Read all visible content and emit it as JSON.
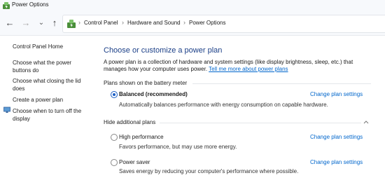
{
  "window": {
    "title": "Power Options"
  },
  "nav": {
    "back_icon": "back-arrow-icon",
    "forward_icon": "forward-arrow-icon",
    "recent_icon": "chevron-down-icon",
    "up_icon": "up-arrow-icon"
  },
  "breadcrumb": [
    "Control Panel",
    "Hardware and Sound",
    "Power Options"
  ],
  "sidebar": {
    "home": "Control Panel Home",
    "links": [
      "Choose what the power",
      "buttons do",
      "Choose what closing the lid",
      "does",
      "Create a power plan",
      "Choose when to turn off the",
      "display"
    ]
  },
  "main": {
    "title": "Choose or customize a power plan",
    "intro_line1": "A power plan is a collection of hardware and system settings (like display brightness, sleep, etc.) that",
    "intro_line2": "manages how your computer uses power.",
    "intro_link": "Tell me more about power plans",
    "battery_group": "Plans shown on the battery meter",
    "hidden_group": "Hide additional plans",
    "change_label": "Change plan settings",
    "plans": [
      {
        "name": "Balanced (recommended)",
        "desc": "Automatically balances performance with energy consumption on capable hardware.",
        "selected": true
      },
      {
        "name": "High performance",
        "desc": "Favors performance, but may use more energy.",
        "selected": false
      },
      {
        "name": "Power saver",
        "desc": "Saves energy by reducing your computer's performance where possible.",
        "selected": false
      }
    ]
  },
  "colors": {
    "title_blue": "#1b3f87",
    "link_blue": "#0066cc",
    "radio_blue": "#1b5fc5"
  }
}
